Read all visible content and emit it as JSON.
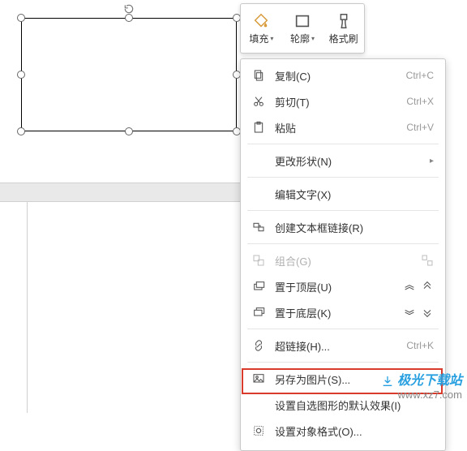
{
  "toolbar": {
    "fill": {
      "label": "填充"
    },
    "outline": {
      "label": "轮廓"
    },
    "format": {
      "label": "格式刷"
    }
  },
  "menu": {
    "copy": {
      "label": "复制(C)",
      "shortcut": "Ctrl+C"
    },
    "cut": {
      "label": "剪切(T)",
      "shortcut": "Ctrl+X"
    },
    "paste": {
      "label": "粘贴",
      "shortcut": "Ctrl+V"
    },
    "changeShape": {
      "label": "更改形状(N)"
    },
    "editText": {
      "label": "编辑文字(X)"
    },
    "linkTextbox": {
      "label": "创建文本框链接(R)"
    },
    "group": {
      "label": "组合(G)"
    },
    "bringFront": {
      "label": "置于顶层(U)"
    },
    "sendBack": {
      "label": "置于底层(K)"
    },
    "hyperlink": {
      "label": "超链接(H)...",
      "shortcut": "Ctrl+K"
    },
    "saveAsPic": {
      "label": "另存为图片(S)..."
    },
    "setDefault": {
      "label": "设置自选图形的默认效果(I)"
    },
    "objFormat": {
      "label": "设置对象格式(O)..."
    }
  },
  "watermark": {
    "name": "极光下载站",
    "url": "www.xz7.com"
  }
}
